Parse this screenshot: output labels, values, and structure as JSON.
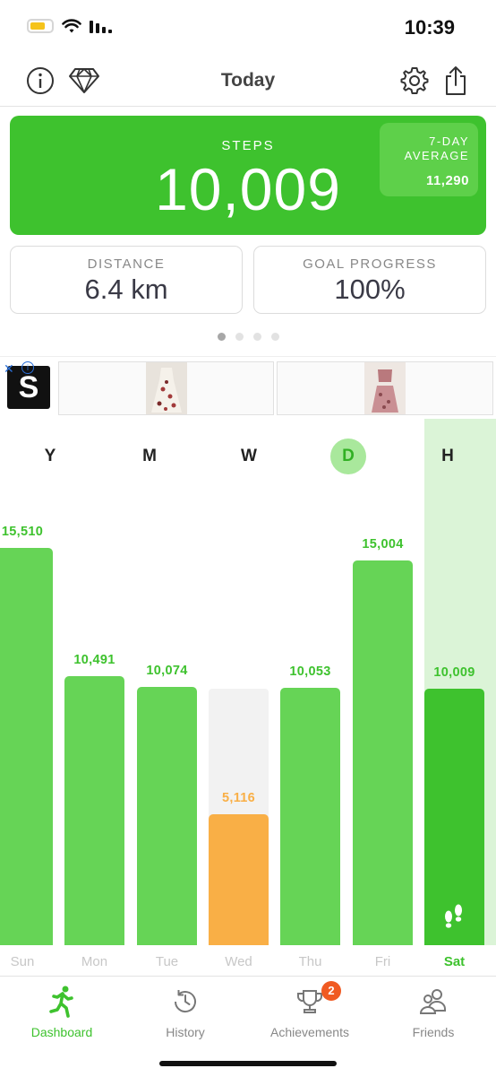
{
  "status_bar": {
    "time": "10:39"
  },
  "nav": {
    "title": "Today",
    "icons": [
      "info-icon",
      "diamond-icon",
      "gear-icon",
      "share-icon"
    ]
  },
  "steps_card": {
    "label": "STEPS",
    "value": "10,009",
    "average_label": "7-DAY AVERAGE",
    "average_value": "11,290",
    "color": "#3ec22e"
  },
  "stats": [
    {
      "label": "DISTANCE",
      "value": "6.4 km"
    },
    {
      "label": "GOAL PROGRESS",
      "value": "100%"
    }
  ],
  "pager": {
    "pages": 4,
    "active": 0
  },
  "ad": {
    "logo": "S"
  },
  "chart_data": {
    "type": "bar",
    "categories": [
      "Sun",
      "Mon",
      "Tue",
      "Wed",
      "Thu",
      "Fri",
      "Sat"
    ],
    "initials": [
      "Y",
      "M",
      "W",
      "D",
      "H"
    ],
    "values": [
      15510,
      10491,
      10074,
      5116,
      10053,
      15004,
      10009
    ],
    "value_labels": [
      "15,510",
      "10,491",
      "10,074",
      "5,116",
      "10,053",
      "15,004",
      "10,009"
    ],
    "goal": 10000,
    "colors": {
      "met": "#66d456",
      "today": "#3ec22e",
      "below": "#f9af46"
    },
    "highlighted_day": "Sat"
  },
  "tabs": [
    {
      "label": "Dashboard",
      "icon": "runner-icon",
      "active": true
    },
    {
      "label": "History",
      "icon": "history-icon"
    },
    {
      "label": "Achievements",
      "icon": "trophy-icon",
      "badge": "2"
    },
    {
      "label": "Friends",
      "icon": "friends-icon"
    }
  ]
}
